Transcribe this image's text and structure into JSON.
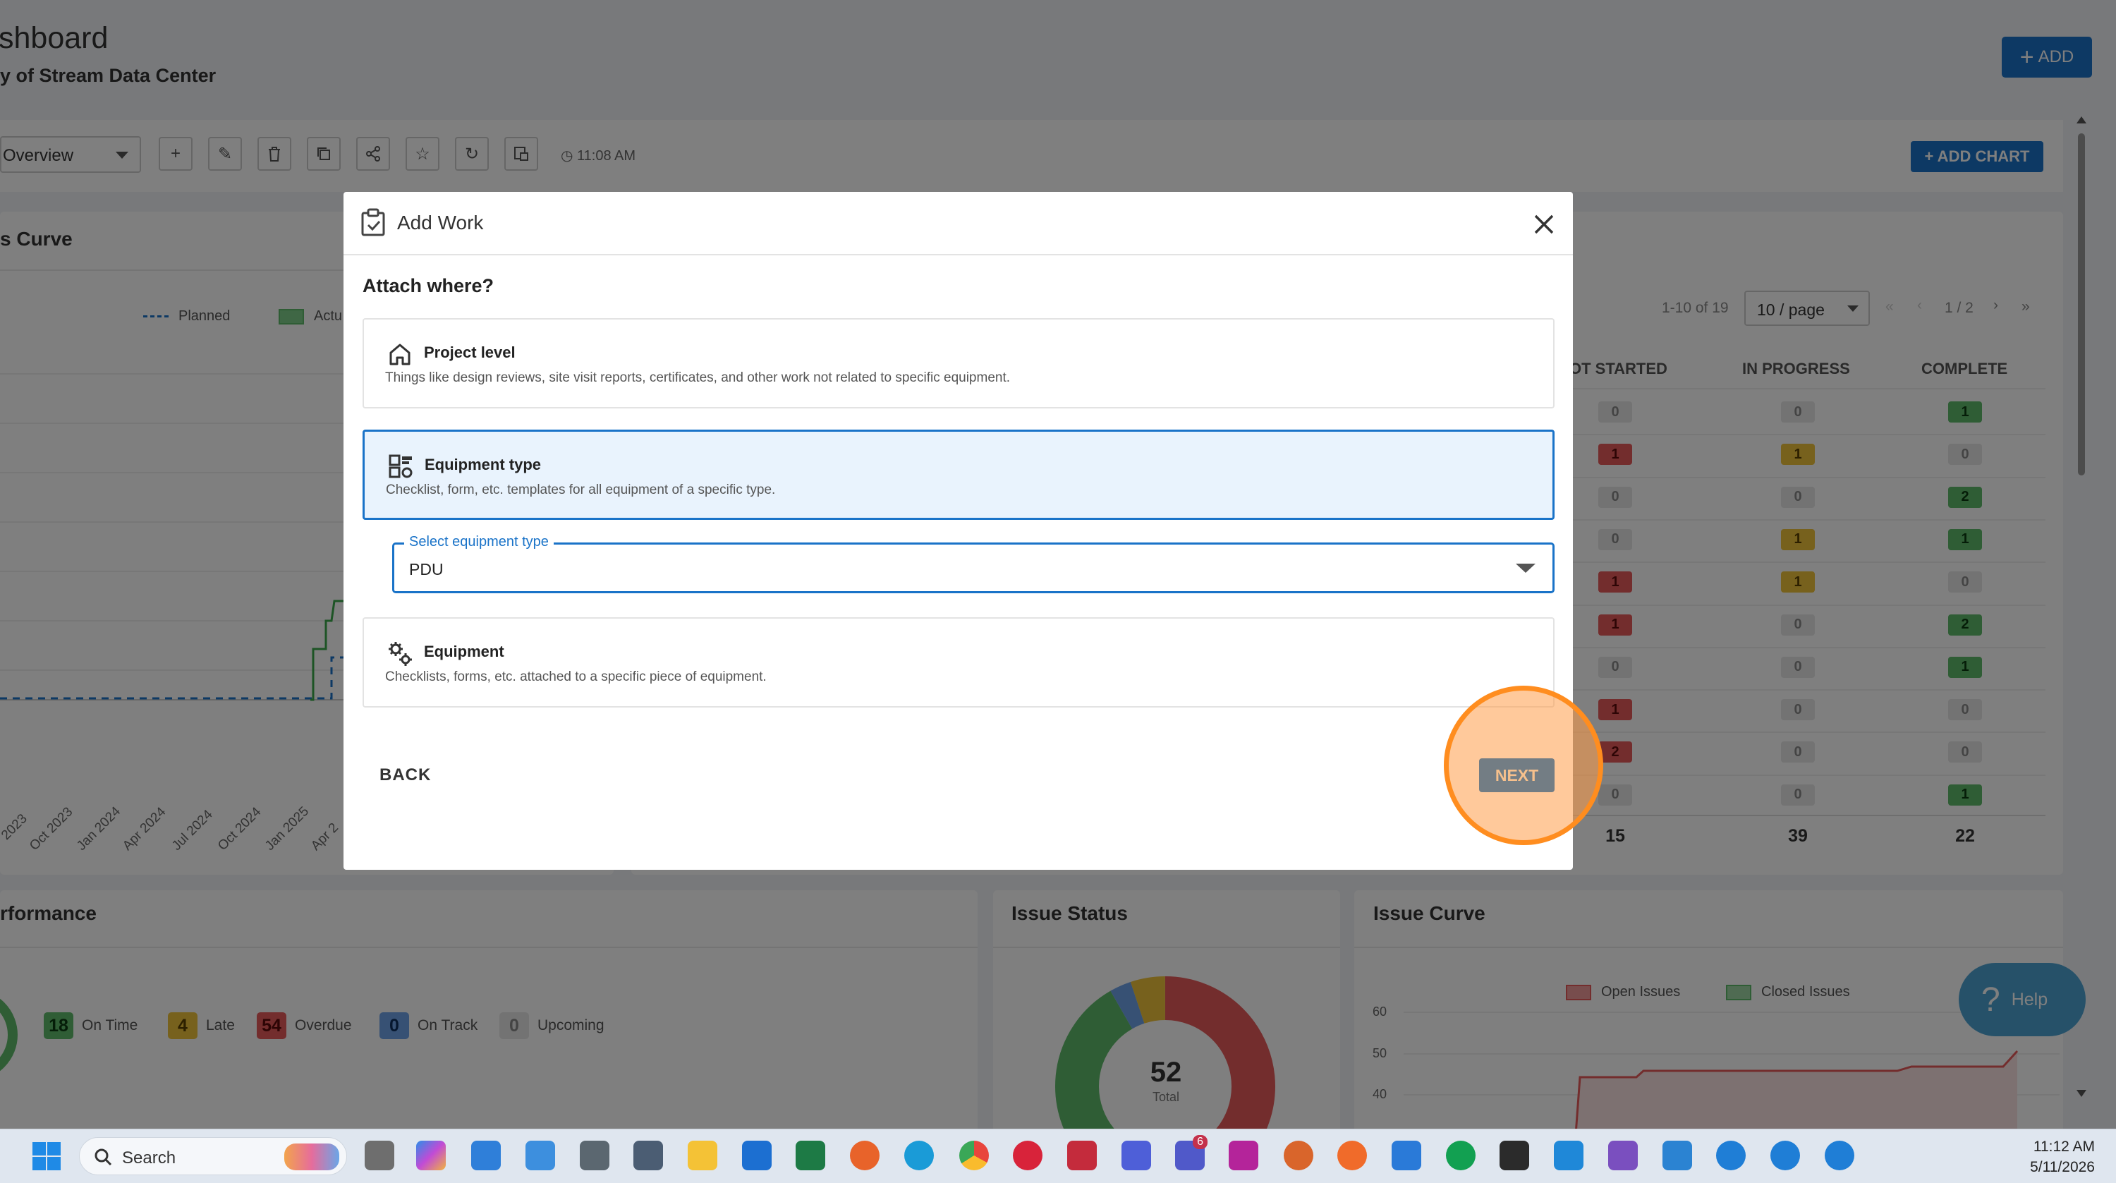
{
  "header": {
    "title": "shboard",
    "subtitle": "y of Stream Data Center",
    "add_label": "ADD"
  },
  "toolbar": {
    "view": "Overview",
    "time": "11:08 AM",
    "add_chart": "+ ADD CHART"
  },
  "s_curve": {
    "title": "s Curve",
    "legend_planned": "Planned",
    "legend_actual": "Actu",
    "x_ticks": [
      "2023",
      "Oct 2023",
      "Jan 2024",
      "Apr 2024",
      "Jul 2024",
      "Oct 2024",
      "Jan 2025",
      "Apr 2"
    ]
  },
  "status_table": {
    "pager_range": "1-10 of 19",
    "per_page": "10 / page",
    "page_info": "1 / 2",
    "pager_first": "«",
    "pager_prev": "‹",
    "pager_next": "›",
    "pager_last": "»",
    "col_not_started": "OT STARTED",
    "col_in_progress": "IN PROGRESS",
    "col_complete": "COMPLETE",
    "rows": [
      [
        "0",
        "0",
        "1"
      ],
      [
        "1",
        "1",
        "0"
      ],
      [
        "0",
        "0",
        "2"
      ],
      [
        "0",
        "1",
        "1"
      ],
      [
        "1",
        "1",
        "0"
      ],
      [
        "1",
        "0",
        "2"
      ],
      [
        "0",
        "0",
        "1"
      ],
      [
        "1",
        "0",
        "0"
      ],
      [
        "2",
        "0",
        "0"
      ],
      [
        "0",
        "0",
        "1"
      ]
    ],
    "totals": [
      "15",
      "39",
      "22"
    ]
  },
  "performance": {
    "title": "rformance",
    "chips": [
      {
        "count": "18",
        "label": "On Time"
      },
      {
        "count": "4",
        "label": "Late"
      },
      {
        "count": "54",
        "label": "Overdue"
      },
      {
        "count": "0",
        "label": "On Track"
      },
      {
        "count": "0",
        "label": "Upcoming"
      }
    ]
  },
  "issue_status": {
    "title": "Issue Status",
    "total": "52",
    "total_label": "Total"
  },
  "issue_curve": {
    "title": "Issue Curve",
    "legend_open": "Open Issues",
    "legend_closed": "Closed Issues",
    "y_ticks": [
      "60",
      "50",
      "40"
    ]
  },
  "help": {
    "label": "Help"
  },
  "modal": {
    "title": "Add Work",
    "question": "Attach where?",
    "options": [
      {
        "title": "Project level",
        "desc": "Things like design reviews, site visit reports, certificates, and other work not related to specific equipment."
      },
      {
        "title": "Equipment type",
        "desc": "Checklist, form, etc. templates for all equipment of a specific type."
      },
      {
        "title": "Equipment",
        "desc": "Checklists, forms, etc. attached to a specific piece of equipment."
      }
    ],
    "select_label": "Select equipment type",
    "select_value": "PDU",
    "back_label": "BACK",
    "next_label": "NEXT"
  },
  "taskbar": {
    "search_label": "Search",
    "teams_badge": "6",
    "time": "11:12 AM",
    "date": "5/11/2026"
  },
  "colors": {
    "accent": "#1a73c8",
    "highlight": "#ff8d1f",
    "not_started": "#e65b5b",
    "in_progress": "#eec23b",
    "complete": "#5fbb6a"
  }
}
